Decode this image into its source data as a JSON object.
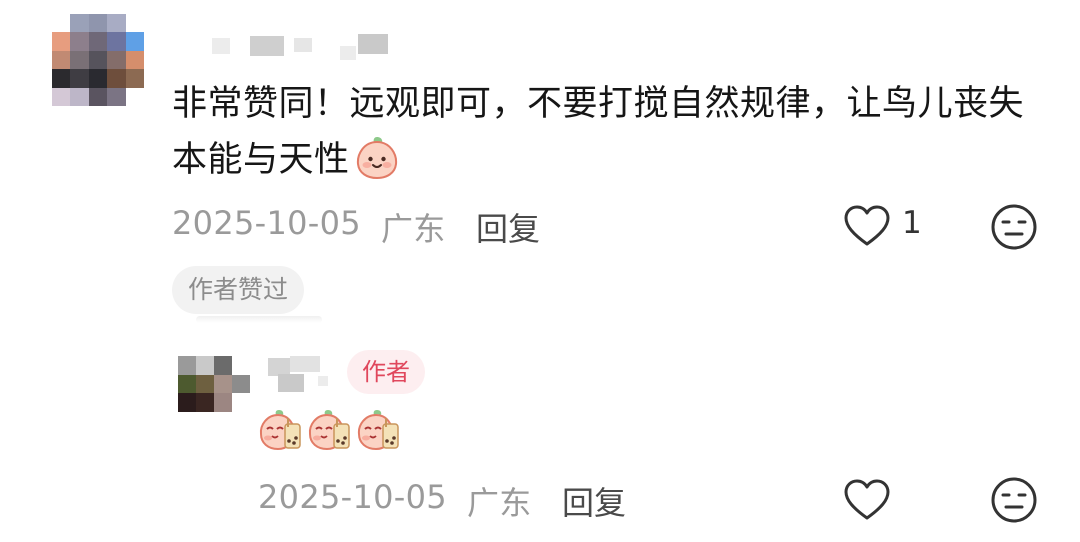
{
  "comment": {
    "text": "非常赞同！远观即可，不要打搅自然规律，让鸟儿丧失本能与天性",
    "emoji_icon": "peach-smile-emoji",
    "date": "2025-10-05",
    "location": "广东",
    "reply_label": "回复",
    "like_count": "1",
    "author_liked_badge": "作者赞过"
  },
  "reply": {
    "author_badge": "作者",
    "emojis": [
      "peach-bubble-tea-emoji",
      "peach-bubble-tea-emoji",
      "peach-bubble-tea-emoji"
    ],
    "date": "2025-10-05",
    "location": "广东",
    "reply_label": "回复"
  },
  "colors": {
    "text": "#161616",
    "meta": "#9a9a9a",
    "author_badge_text": "#e0475c",
    "author_badge_bg": "#fdeef0"
  }
}
